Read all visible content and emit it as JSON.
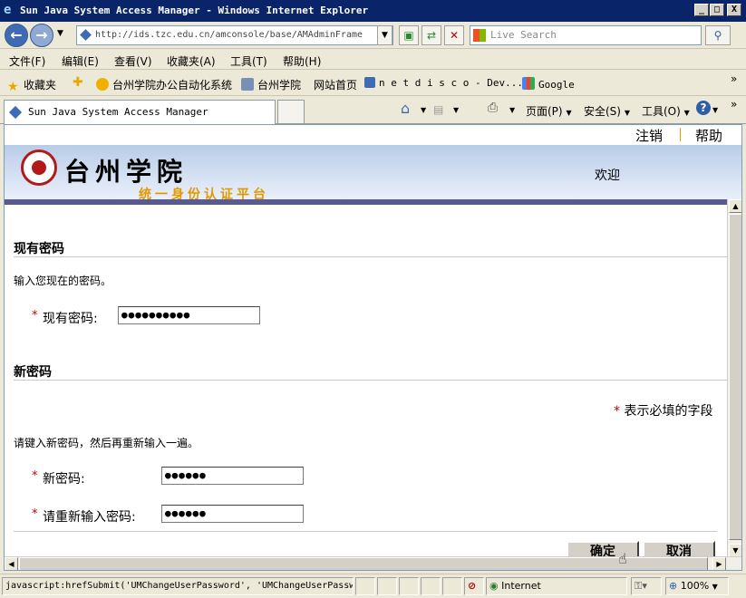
{
  "window": {
    "title": "Sun Java System Access Manager - Windows Internet Explorer",
    "minimize": "_",
    "maximize": "□",
    "close": "X"
  },
  "address": {
    "url": "http://ids.tzc.edu.cn/amconsole/base/AMAdminFrame",
    "search_placeholder": "Live Search"
  },
  "menubar": [
    "文件(F)",
    "编辑(E)",
    "查看(V)",
    "收藏夹(A)",
    "工具(T)",
    "帮助(H)"
  ],
  "favorites": {
    "label": "收藏夹",
    "items": [
      "台州学院办公自动化系统",
      "台州学院",
      "网站首页",
      "n e t d i s c o - Dev...",
      "Google"
    ]
  },
  "tab": {
    "title": "Sun Java System Access Manager"
  },
  "toolbar": {
    "page": "页面(P)",
    "safety": "安全(S)",
    "tools": "工具(O)"
  },
  "page": {
    "nav": {
      "logout": "注销",
      "help": "帮助"
    },
    "banner": {
      "school": "台州学院",
      "subtitle": "统一身份认证平台",
      "welcome": "欢迎"
    },
    "current_section": {
      "title": "现有密码",
      "instruction": "输入您现在的密码。",
      "label": "现有密码:",
      "value": "●●●●●●●●●●"
    },
    "new_section": {
      "title": "新密码",
      "required_note": "表示必填的字段",
      "instruction": "请键入新密码，然后再重新输入一遍。",
      "new_label": "新密码:",
      "new_value": "●●●●●●",
      "confirm_label": "请重新输入密码:",
      "confirm_value": "●●●●●●"
    },
    "required_star": "*",
    "buttons": {
      "ok": "确定",
      "cancel": "取消"
    }
  },
  "status": {
    "text": "javascript:hrefSubmit('UMChangeUserPassword', 'UMChangeUserPassw",
    "zone": "Internet",
    "zoom": "100%"
  }
}
